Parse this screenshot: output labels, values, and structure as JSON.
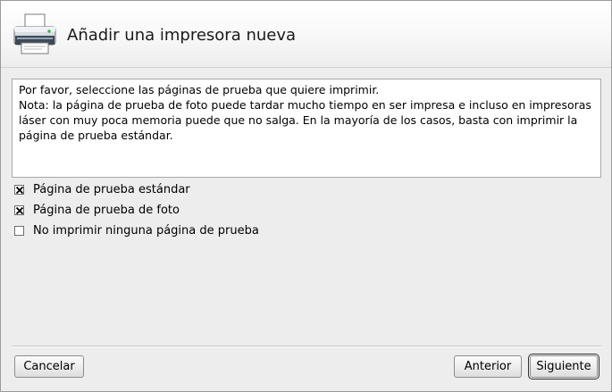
{
  "dialog": {
    "title": "Añadir una impresora nueva",
    "icon": "printer-icon"
  },
  "info": {
    "line1": "Por favor, seleccione las páginas de prueba que quiere imprimir.",
    "line2": "Nota: la página de prueba de foto puede tardar mucho tiempo en ser impresa e incluso en impresoras láser con muy poca memoria puede que no salga. En la mayoría de los casos, basta con imprimir la página de prueba estándar."
  },
  "options": [
    {
      "label": "Página de prueba estándar",
      "checked": true
    },
    {
      "label": "Página de prueba de foto",
      "checked": true
    },
    {
      "label": "No imprimir ninguna página de prueba",
      "checked": false
    }
  ],
  "buttons": {
    "cancel": "Cancelar",
    "back": "Anterior",
    "next": "Siguiente"
  }
}
